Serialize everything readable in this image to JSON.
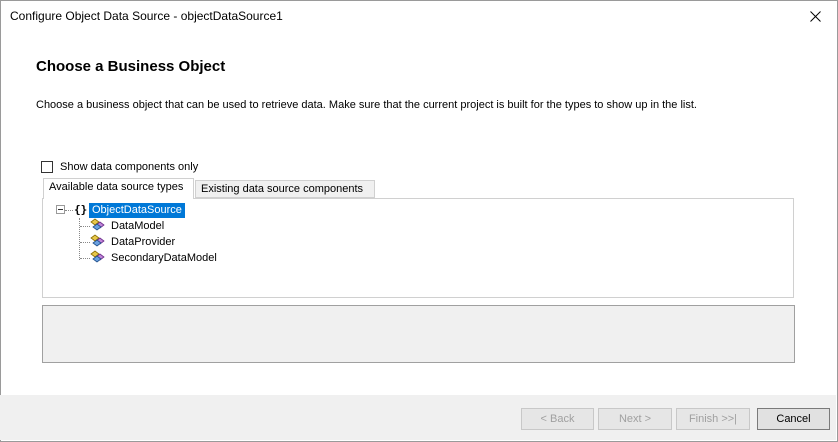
{
  "window": {
    "title": "Configure Object Data Source - objectDataSource1"
  },
  "page": {
    "heading": "Choose a Business Object",
    "description": "Choose a business object that can be used to retrieve data. Make sure that the current project is built for the types to show up in the list."
  },
  "options": {
    "show_data_components_label": "Show data components only",
    "show_data_components_checked": false
  },
  "tabs": [
    {
      "label": "Available data source types",
      "active": true
    },
    {
      "label": "Existing data source components",
      "active": false
    }
  ],
  "tree": {
    "root": {
      "label": "ObjectDataSource",
      "icon": "braces-icon",
      "selected": true,
      "expanded": true
    },
    "children": [
      {
        "label": "DataModel",
        "icon": "class-icon"
      },
      {
        "label": "DataProvider",
        "icon": "class-icon"
      },
      {
        "label": "SecondaryDataModel",
        "icon": "class-icon"
      }
    ]
  },
  "buttons": {
    "back": "< Back",
    "next": "Next >",
    "finish": "Finish >>|",
    "cancel": "Cancel"
  },
  "colors": {
    "selection": "#0078d7",
    "footer_bg": "#f0f0f0",
    "description_bg": "#f0f0f0"
  }
}
